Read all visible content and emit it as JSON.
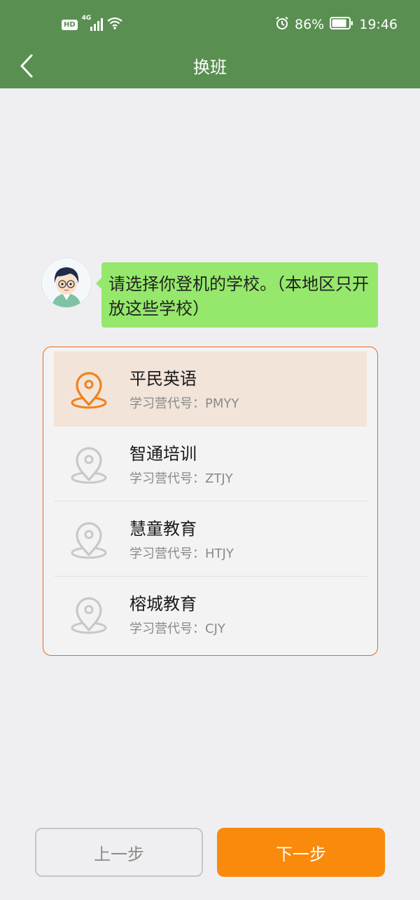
{
  "status_bar": {
    "network_badge": "HD",
    "network_type": "4G",
    "battery_percent": "86%",
    "battery_level": 0.86,
    "time": "19:46"
  },
  "header": {
    "title": "换班",
    "back_icon": "chevron-left-icon",
    "background_color": "#5a8f52"
  },
  "chat": {
    "message": "请选择你登机的学校。（本地区只开放这些学校）",
    "bubble_color": "#95e86b"
  },
  "schools": [
    {
      "name": "平民英语",
      "code_label": "学习营代号：PMYY",
      "selected": true
    },
    {
      "name": "智通培训",
      "code_label": "学习营代号：ZTJY",
      "selected": false
    },
    {
      "name": "慧童教育",
      "code_label": "学习营代号：HTJY",
      "selected": false
    },
    {
      "name": "榕城教育",
      "code_label": "学习营代号：CJY",
      "selected": false
    }
  ],
  "buttons": {
    "prev_label": "上一步",
    "next_label": "下一步"
  },
  "colors": {
    "accent": "#f98a0c",
    "selected_pin": "#f0811c",
    "unselected_pin": "#c8c8c8",
    "card_border": "#e46a1e"
  }
}
